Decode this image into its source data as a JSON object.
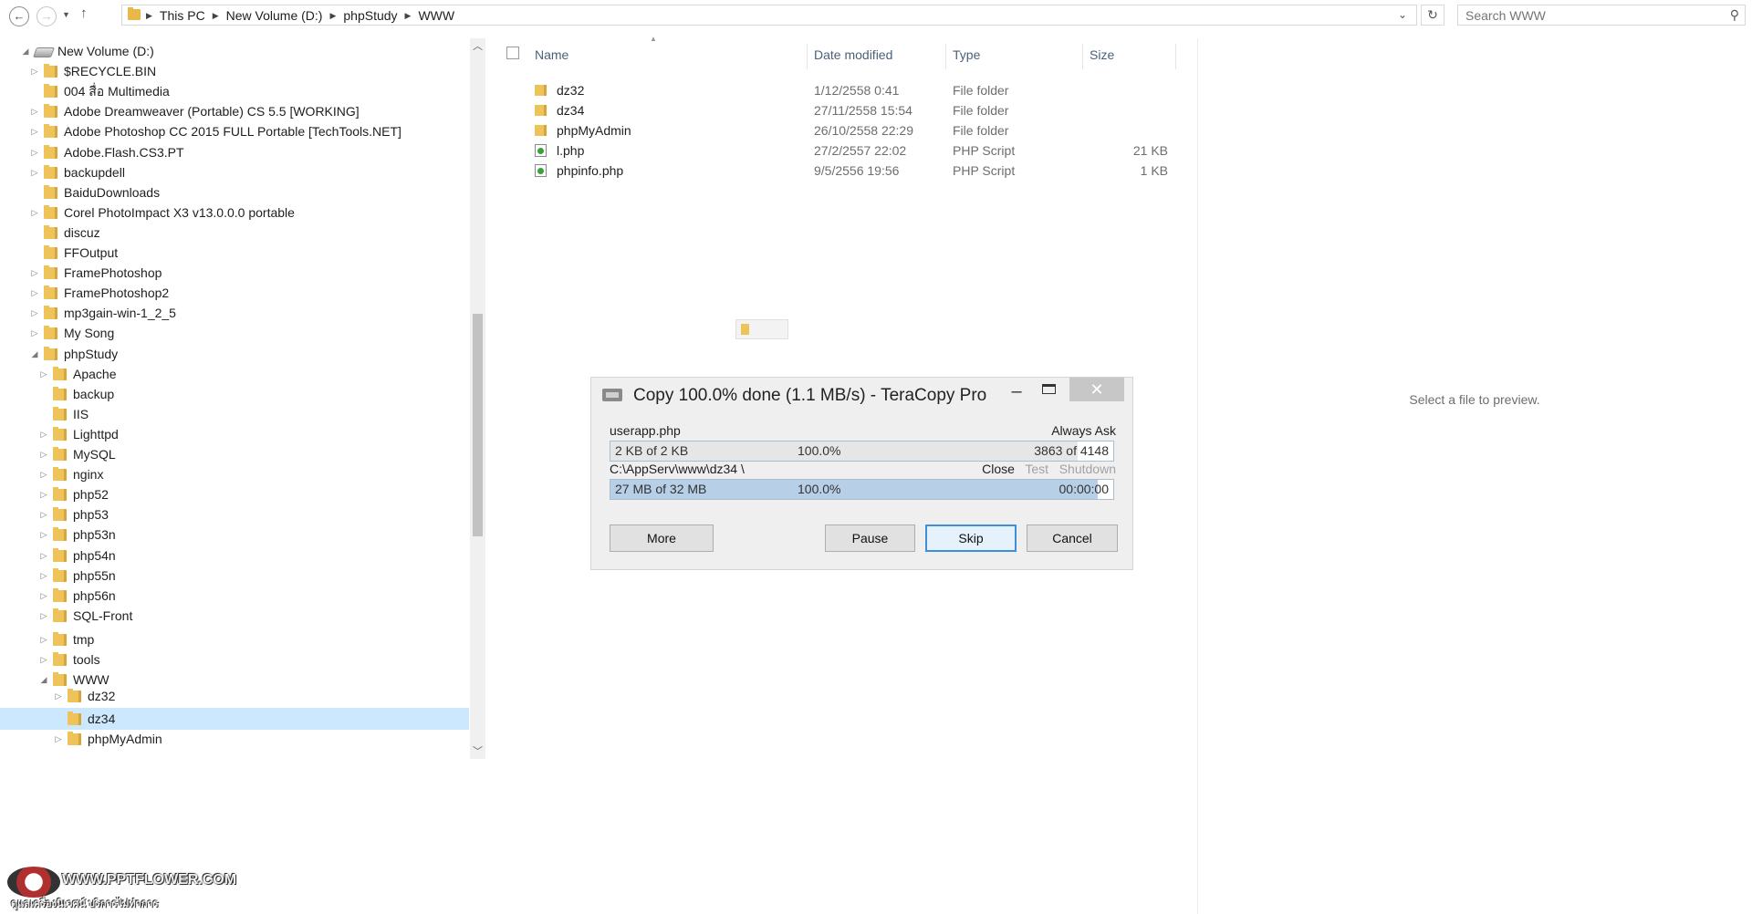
{
  "address_bar": {
    "crumbs": [
      "This PC",
      "New Volume (D:)",
      "phpStudy",
      "WWW"
    ],
    "search_placeholder": "Search WWW"
  },
  "nav_tree": {
    "items": [
      {
        "label": "New Volume (D:)",
        "level": 0,
        "state": "expanded",
        "icon": "drive-icon"
      },
      {
        "label": "$RECYCLE.BIN",
        "level": 1,
        "state": "collapsed"
      },
      {
        "label": "004 สื่อ Multimedia",
        "level": 1,
        "state": "none"
      },
      {
        "label": "Adobe Dreamweaver (Portable) CS 5.5 [WORKING]",
        "level": 1,
        "state": "collapsed"
      },
      {
        "label": "Adobe Photoshop CC 2015 FULL Portable [TechTools.NET]",
        "level": 1,
        "state": "collapsed"
      },
      {
        "label": "Adobe.Flash.CS3.PT",
        "level": 1,
        "state": "collapsed"
      },
      {
        "label": "backupdell",
        "level": 1,
        "state": "collapsed"
      },
      {
        "label": "BaiduDownloads",
        "level": 1,
        "state": "none"
      },
      {
        "label": "Corel PhotoImpact X3 v13.0.0.0 portable",
        "level": 1,
        "state": "collapsed"
      },
      {
        "label": "discuz",
        "level": 1,
        "state": "none"
      },
      {
        "label": "FFOutput",
        "level": 1,
        "state": "none"
      },
      {
        "label": "FramePhotoshop",
        "level": 1,
        "state": "collapsed"
      },
      {
        "label": "FramePhotoshop2",
        "level": 1,
        "state": "collapsed"
      },
      {
        "label": "mp3gain-win-1_2_5",
        "level": 1,
        "state": "collapsed"
      },
      {
        "label": "My Song",
        "level": 1,
        "state": "collapsed"
      },
      {
        "label": "phpStudy",
        "level": 1,
        "state": "expanded"
      },
      {
        "label": "Apache",
        "level": 2,
        "state": "collapsed"
      },
      {
        "label": "backup",
        "level": 2,
        "state": "none"
      },
      {
        "label": "IIS",
        "level": 2,
        "state": "none"
      },
      {
        "label": "Lighttpd",
        "level": 2,
        "state": "collapsed"
      },
      {
        "label": "MySQL",
        "level": 2,
        "state": "collapsed"
      },
      {
        "label": "nginx",
        "level": 2,
        "state": "collapsed"
      },
      {
        "label": "php52",
        "level": 2,
        "state": "collapsed"
      },
      {
        "label": "php53",
        "level": 2,
        "state": "collapsed"
      },
      {
        "label": "php53n",
        "level": 2,
        "state": "collapsed"
      },
      {
        "label": "php54n",
        "level": 2,
        "state": "collapsed"
      },
      {
        "label": "php55n",
        "level": 2,
        "state": "collapsed"
      },
      {
        "label": "php56n",
        "level": 2,
        "state": "collapsed"
      },
      {
        "label": "SQL-Front",
        "level": 2,
        "state": "collapsed"
      },
      {
        "label": "tmp",
        "level": 2,
        "state": "collapsed"
      },
      {
        "label": "tools",
        "level": 2,
        "state": "collapsed"
      },
      {
        "label": "WWW",
        "level": 2,
        "state": "expanded"
      },
      {
        "label": "dz32",
        "level": 3,
        "state": "collapsed"
      },
      {
        "label": "dz34",
        "level": 3,
        "state": "none",
        "selected": true
      },
      {
        "label": "phpMyAdmin",
        "level": 3,
        "state": "collapsed"
      }
    ]
  },
  "file_list": {
    "columns": {
      "name": "Name",
      "date": "Date modified",
      "type": "Type",
      "size": "Size"
    },
    "rows": [
      {
        "name": "dz32",
        "date": "1/12/2558 0:41",
        "type": "File folder",
        "size": "",
        "icon": "folder-icon"
      },
      {
        "name": "dz34",
        "date": "27/11/2558 15:54",
        "type": "File folder",
        "size": "",
        "icon": "folder-icon"
      },
      {
        "name": "phpMyAdmin",
        "date": "26/10/2558 22:29",
        "type": "File folder",
        "size": "",
        "icon": "folder-icon"
      },
      {
        "name": "l.php",
        "date": "27/2/2557 22:02",
        "type": "PHP Script",
        "size": "21 KB",
        "icon": "php-file-icon"
      },
      {
        "name": "phpinfo.php",
        "date": "9/5/2556 19:56",
        "type": "PHP Script",
        "size": "1 KB",
        "icon": "php-file-icon"
      }
    ]
  },
  "preview": {
    "text": "Select a file to preview."
  },
  "teracopy": {
    "title": "Copy 100.0% done (1.1 MB/s) - TeraCopy Pro",
    "current_file": "userapp.php",
    "overwrite_mode": "Always Ask",
    "file_progress": {
      "left": "2 KB of 2 KB",
      "percent": "100.0%",
      "right": "3863 of 4148",
      "fraction": 0.93
    },
    "target_path": "C:\\AppServ\\www\\dz34 \\",
    "after_options": {
      "close": "Close",
      "test": "Test",
      "shutdown": "Shutdown"
    },
    "total_progress": {
      "left": "27 MB of 32 MB",
      "percent": "100.0%",
      "right": "00:00:00",
      "fraction": 0.97
    },
    "buttons": {
      "more": "More",
      "pause": "Pause",
      "skip": "Skip",
      "cancel": "Cancel"
    },
    "close_glyph": "✕"
  },
  "watermark": {
    "site": "WWW.PPTFLOWER.COM",
    "tagline": "ดูแลเครื่องนิเวศน์ บริการไม่ทำการ"
  },
  "colors": {
    "selection": "#cce8ff",
    "header_text": "#4c607a",
    "progress_blue": "#b7cfe7"
  }
}
